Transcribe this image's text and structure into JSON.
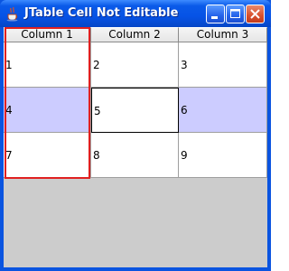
{
  "window": {
    "title": "JTable Cell Not Editable",
    "icons": {
      "app": "java-cup-icon",
      "minimize": "minimize-icon",
      "maximize": "maximize-icon",
      "close": "close-icon"
    }
  },
  "table": {
    "columns": [
      "Column 1",
      "Column 2",
      "Column 3"
    ],
    "rows": [
      [
        "1",
        "2",
        "3"
      ],
      [
        "4",
        "5",
        "6"
      ],
      [
        "7",
        "8",
        "9"
      ]
    ],
    "selected_row": 1,
    "focused_cell": {
      "row": 1,
      "col": 1
    },
    "highlighted_column": 0,
    "colors": {
      "selection": "#ccccff",
      "highlight_border": "#e02020",
      "empty_area": "#cccccc"
    }
  }
}
